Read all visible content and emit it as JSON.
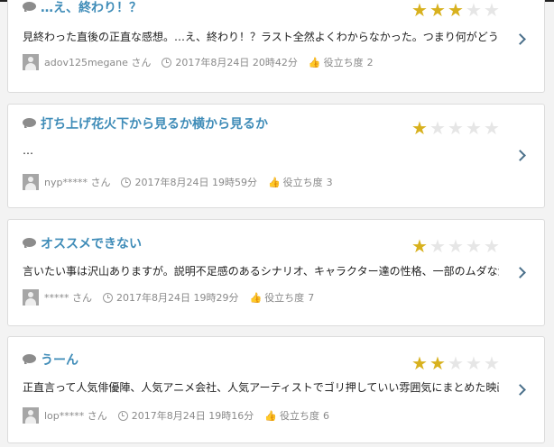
{
  "reviews": [
    {
      "title": "…え、終わり！？",
      "rating": 3,
      "body": "見終わった直後の正直な感想。…え、終わり！？ラスト全然よくわからなかった。つまり何がどうなった…",
      "user": "adov125megane さん",
      "datetime": "2017年8月24日 20時42分",
      "helpful_label": "役立ち度",
      "helpful_count": "2"
    },
    {
      "title": "打ち上げ花火下から見るか横から見るか",
      "rating": 1,
      "body": "…",
      "user": "nyp***** さん",
      "datetime": "2017年8月24日 19時59分",
      "helpful_label": "役立ち度",
      "helpful_count": "3"
    },
    {
      "title": "オススメできない",
      "rating": 1,
      "body": "言いたい事は沢山ありますが。説明不足感のあるシナリオ、キャラクター達の性格、一部のムダな演出…",
      "user": "***** さん",
      "datetime": "2017年8月24日 19時29分",
      "helpful_label": "役立ち度",
      "helpful_count": "7"
    },
    {
      "title": "うーん",
      "rating": 2,
      "body": "正直言って人気俳優陣、人気アニメ会社、人気アーティストでゴリ押していい雰囲気にまとめた映画。個…",
      "user": "lop***** さん",
      "datetime": "2017年8月24日 19時16分",
      "helpful_label": "役立ち度",
      "helpful_count": "6"
    }
  ],
  "colors": {
    "title": "#3f8cb8",
    "star_on": "#d8b11e",
    "star_off": "#e6e6e6"
  },
  "icons": {
    "comment": "speech-bubble-icon",
    "user": "user-avatar-icon",
    "time": "clock-icon",
    "helpful": "thumbs-up-icon",
    "open": "chevron-right-icon"
  }
}
